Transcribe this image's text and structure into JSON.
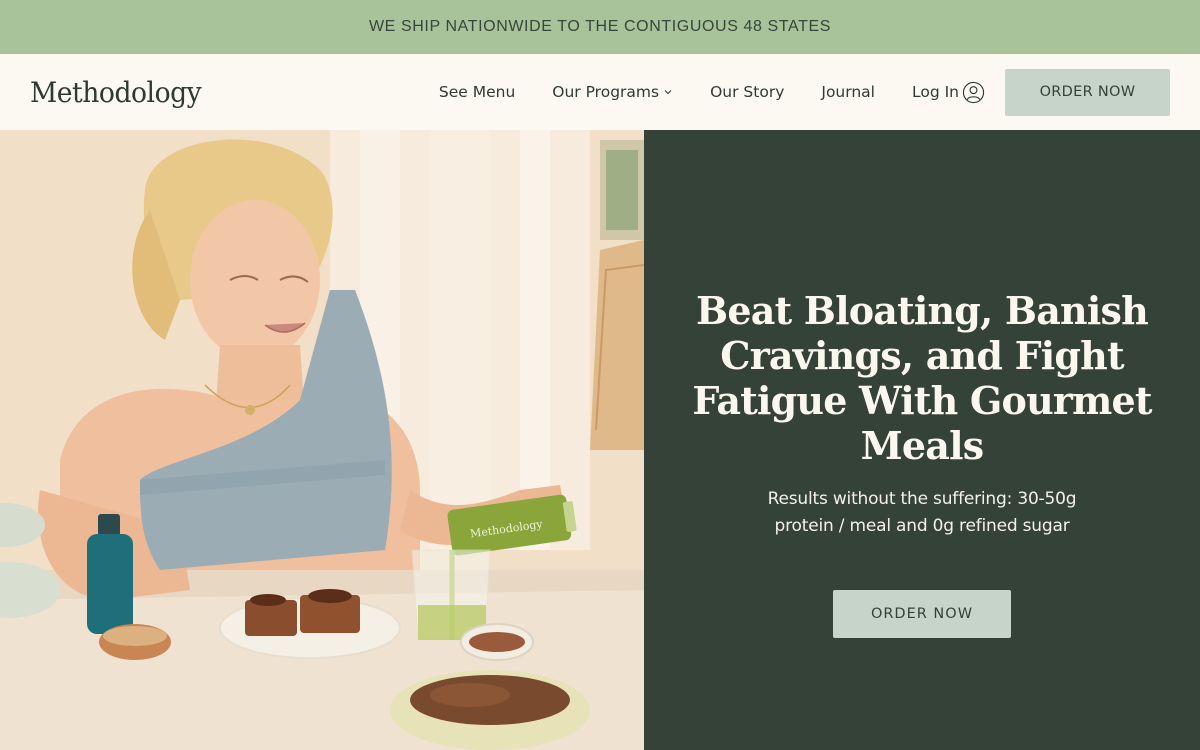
{
  "announcement": "WE SHIP NATIONWIDE TO THE CONTIGUOUS 48 STATES",
  "header": {
    "logo": "Methodology",
    "nav": [
      {
        "label": "See Menu"
      },
      {
        "label": "Our Programs"
      },
      {
        "label": "Our Story"
      },
      {
        "label": "Journal"
      }
    ],
    "login_label": "Log In",
    "order_label": "ORDER NOW"
  },
  "hero": {
    "headline": "Beat Bloating, Banish Cravings, and Fight Fatigue With Gourmet Meals",
    "subhead": "Results without the suffering: 30-50g protein / meal and 0g refined sugar",
    "cta_label": "ORDER NOW",
    "image_alt": "Woman pouring a green juice over a table of gourmet meals",
    "bottle_text": "Methodology"
  },
  "colors": {
    "announce_bg": "#a8c29a",
    "header_bg": "#fbf9f2",
    "hero_panel_bg": "#354238",
    "button_bg": "#c7d4ca",
    "text_dark": "#2f3a33"
  },
  "icons": {
    "nav_dropdown": "chevron-down-icon",
    "login": "user-circle-icon"
  }
}
